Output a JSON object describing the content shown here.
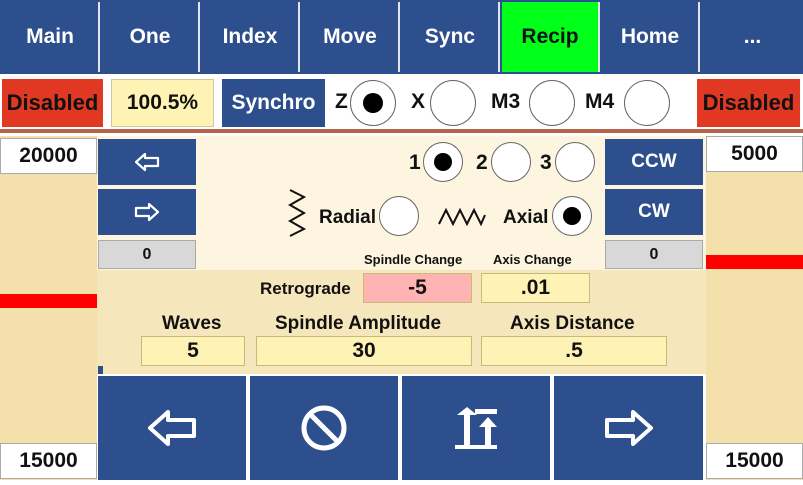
{
  "tabs": [
    {
      "label": "Main",
      "active": false
    },
    {
      "label": "One",
      "active": false
    },
    {
      "label": "Index",
      "active": false
    },
    {
      "label": "Move",
      "active": false
    },
    {
      "label": "Sync",
      "active": false
    },
    {
      "label": "Recip",
      "active": true
    },
    {
      "label": "Home",
      "active": false
    },
    {
      "label": "...",
      "active": false
    }
  ],
  "status": {
    "left_state": "Disabled",
    "percent": "100.5%",
    "synchro_label": "Synchro",
    "axes": [
      {
        "label": "Z",
        "selected": true
      },
      {
        "label": "X",
        "selected": false
      },
      {
        "label": "M3",
        "selected": false
      },
      {
        "label": "M4",
        "selected": false
      }
    ],
    "right_state": "Disabled"
  },
  "left_gauge": {
    "top_value": "20000",
    "bottom_value": "15000"
  },
  "right_gauge": {
    "top_value": "5000",
    "bottom_value": "15000"
  },
  "center": {
    "left_arrow_icon": "arrow-left-icon",
    "right_arrow_icon": "arrow-right-icon",
    "left_counter": "0",
    "right_counter": "0",
    "ccw_label": "CCW",
    "cw_label": "CW",
    "channels": [
      {
        "label": "1",
        "selected": true
      },
      {
        "label": "2",
        "selected": false
      },
      {
        "label": "3",
        "selected": false
      }
    ],
    "radial_label": "Radial",
    "radial_selected": false,
    "axial_label": "Axial",
    "axial_selected": true,
    "spindle_change_label": "Spindle Change",
    "axis_change_label": "Axis Change",
    "retrograde_label": "Retrograde",
    "spindle_change_value": "-5",
    "axis_change_value": ".01",
    "waves_label": "Waves",
    "spindle_amplitude_label": "Spindle Amplitude",
    "axis_distance_label": "Axis Distance",
    "waves_value": "5",
    "spindle_amplitude_value": "30",
    "axis_distance_value": ".5"
  },
  "bottom_buttons": [
    {
      "icon": "arrow-left-icon"
    },
    {
      "icon": "stop-icon"
    },
    {
      "icon": "sort-up-icon"
    },
    {
      "icon": "arrow-right-icon"
    }
  ],
  "colors": {
    "navy": "#2d4f8e",
    "active_tab": "#00ff19",
    "disabled": "#e03822",
    "field": "#fff2b5",
    "marker": "#ff0000"
  }
}
